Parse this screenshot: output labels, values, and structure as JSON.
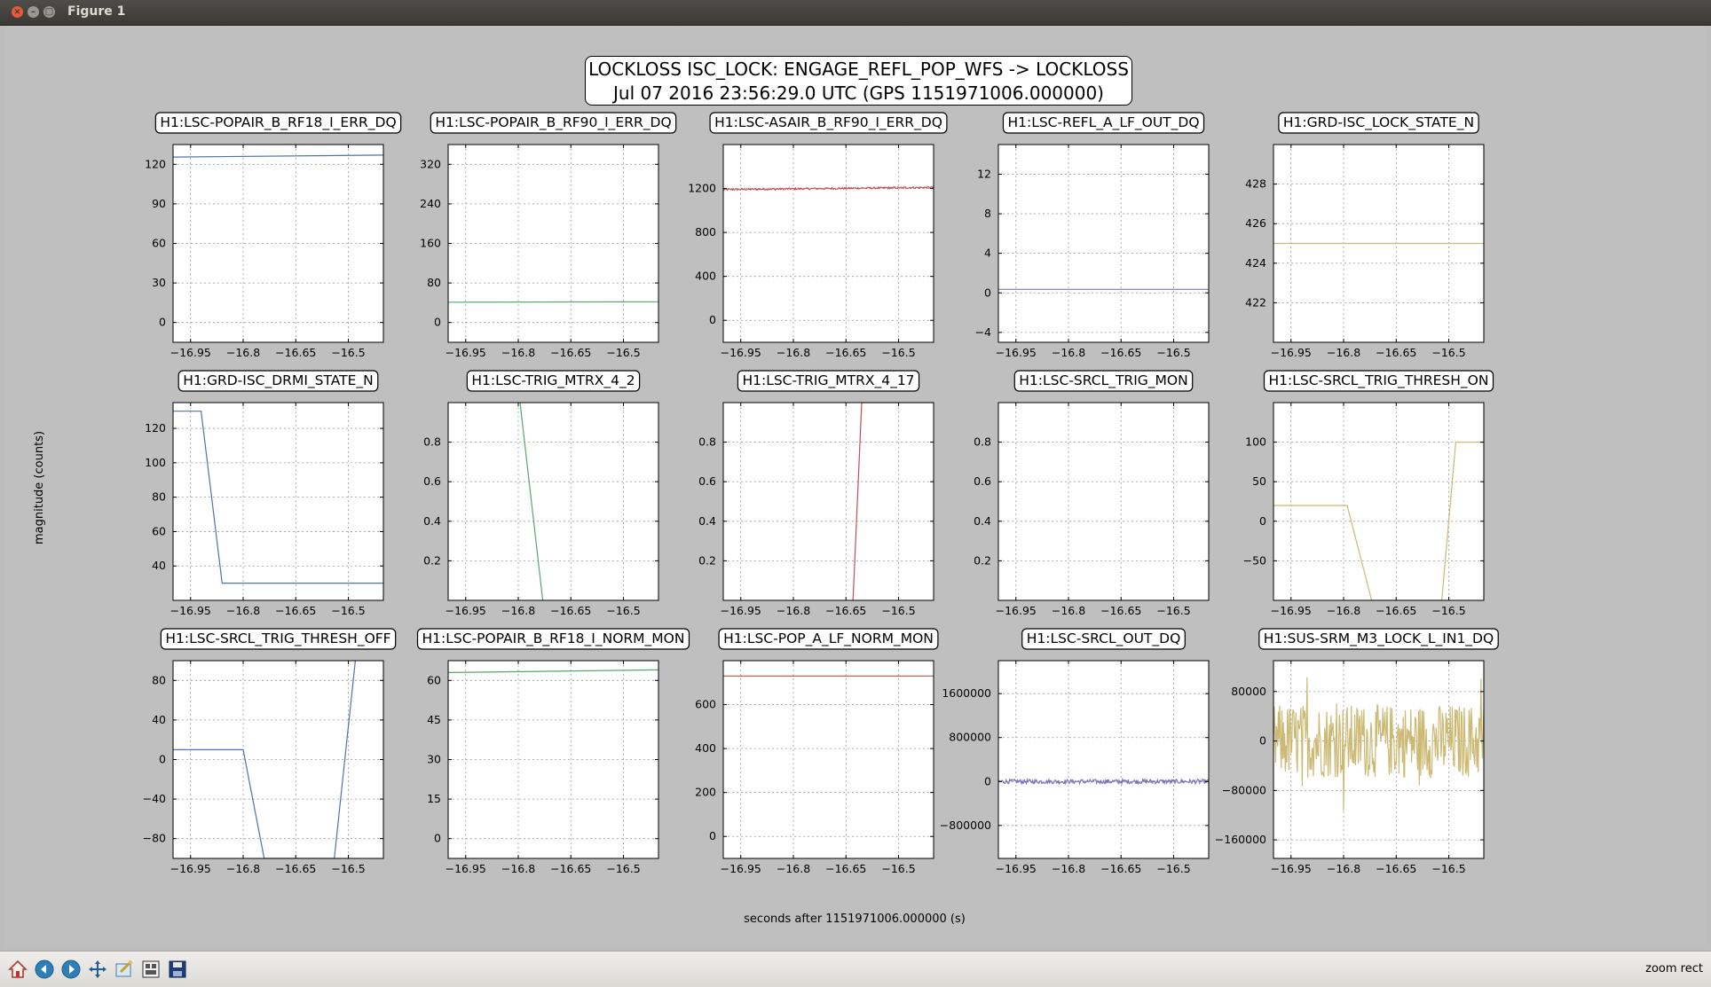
{
  "window": {
    "title": "Figure 1",
    "close_glyph": "×",
    "min_glyph": "–",
    "max_glyph": "□"
  },
  "figure": {
    "title_line1": "LOCKLOSS ISC_LOCK: ENGAGE_REFL_POP_WFS -> LOCKLOSS",
    "title_line2": "Jul 07 2016 23:56:29.0 UTC (GPS 1151971006.000000)",
    "ylabel": "magnitude (counts)",
    "xlabel": "seconds after 1151971006.000000 (s)",
    "grid": true
  },
  "toolbar": {
    "buttons": [
      "home-icon",
      "back-icon",
      "forward-icon",
      "pan-icon",
      "zoom-icon",
      "subplots-icon",
      "save-icon"
    ],
    "status": "zoom rect"
  },
  "colors": {
    "blue": "#4c72b0",
    "green": "#55a868",
    "red": "#c44e52",
    "purple": "#8172b2",
    "gold": "#ccb974"
  },
  "chart_data": [
    {
      "type": "line",
      "title": "H1:LSC-POPAIR_B_RF18_I_ERR_DQ",
      "xlim": [
        -17.0,
        -16.4
      ],
      "ylim": [
        -15,
        135
      ],
      "yticks": [
        0,
        30,
        60,
        90,
        120
      ],
      "ytick_labels": [
        "0",
        "30",
        "60",
        "90",
        "120"
      ],
      "color": "#4c72b0",
      "series": [
        {
          "x": [
            -17.0,
            -16.4
          ],
          "y": [
            125.5,
            127.0
          ]
        }
      ]
    },
    {
      "type": "line",
      "title": "H1:LSC-POPAIR_B_RF90_I_ERR_DQ",
      "xlim": [
        -17.0,
        -16.4
      ],
      "ylim": [
        -40,
        360
      ],
      "yticks": [
        0,
        80,
        160,
        240,
        320
      ],
      "ytick_labels": [
        "0",
        "80",
        "160",
        "240",
        "320"
      ],
      "color": "#55a868",
      "series": [
        {
          "x": [
            -17.0,
            -16.4
          ],
          "y": [
            41,
            42
          ]
        }
      ]
    },
    {
      "type": "line",
      "title": "H1:LSC-ASAIR_B_RF90_I_ERR_DQ",
      "xlim": [
        -17.0,
        -16.4
      ],
      "ylim": [
        -200,
        1600
      ],
      "yticks": [
        0,
        400,
        800,
        1200
      ],
      "ytick_labels": [
        "0",
        "400",
        "800",
        "1200"
      ],
      "color": "#c44e52",
      "noise": 8,
      "series": [
        {
          "x": [
            -17.0,
            -16.4
          ],
          "y": [
            1190,
            1210
          ]
        }
      ]
    },
    {
      "type": "line",
      "title": "H1:LSC-REFL_A_LF_OUT_DQ",
      "xlim": [
        -17.0,
        -16.4
      ],
      "ylim": [
        -5,
        15
      ],
      "yticks": [
        -4,
        0,
        4,
        8,
        12
      ],
      "ytick_labels": [
        "−4",
        "0",
        "4",
        "8",
        "12"
      ],
      "color": "#8172b2",
      "series": [
        {
          "x": [
            -17.0,
            -16.4
          ],
          "y": [
            0.35,
            0.35
          ]
        }
      ]
    },
    {
      "type": "line",
      "title": "H1:GRD-ISC_LOCK_STATE_N",
      "xlim": [
        -17.0,
        -16.4
      ],
      "ylim": [
        420,
        430
      ],
      "yticks": [
        422,
        424,
        426,
        428
      ],
      "ytick_labels": [
        "422",
        "424",
        "426",
        "428"
      ],
      "color": "#ccb974",
      "series": [
        {
          "x": [
            -17.0,
            -16.4
          ],
          "y": [
            425,
            425
          ]
        }
      ]
    },
    {
      "type": "line",
      "title": "H1:GRD-ISC_DRMI_STATE_N",
      "xlim": [
        -17.0,
        -16.4
      ],
      "ylim": [
        20,
        135
      ],
      "yticks": [
        40,
        60,
        80,
        100,
        120
      ],
      "ytick_labels": [
        "40",
        "60",
        "80",
        "100",
        "120"
      ],
      "color": "#4c72b0",
      "series": [
        {
          "x": [
            -17.0,
            -16.92,
            -16.86,
            -16.4
          ],
          "y": [
            130,
            130,
            30,
            30
          ]
        }
      ]
    },
    {
      "type": "line",
      "title": "H1:LSC-TRIG_MTRX_4_2",
      "xlim": [
        -17.0,
        -16.4
      ],
      "ylim": [
        0,
        1
      ],
      "yticks": [
        0.2,
        0.4,
        0.6,
        0.8
      ],
      "ytick_labels": [
        "0.2",
        "0.4",
        "0.6",
        "0.8"
      ],
      "color": "#55a868",
      "series": [
        {
          "x": [
            -16.795,
            -16.73
          ],
          "y": [
            1,
            0
          ]
        }
      ]
    },
    {
      "type": "line",
      "title": "H1:LSC-TRIG_MTRX_4_17",
      "xlim": [
        -17.0,
        -16.4
      ],
      "ylim": [
        0,
        1
      ],
      "yticks": [
        0.2,
        0.4,
        0.6,
        0.8
      ],
      "ytick_labels": [
        "0.2",
        "0.4",
        "0.6",
        "0.8"
      ],
      "color": "#c44e52",
      "series": [
        {
          "x": [
            -16.63,
            -16.605,
            -16.4
          ],
          "y": [
            0,
            1,
            1
          ]
        }
      ]
    },
    {
      "type": "line",
      "title": "H1:LSC-SRCL_TRIG_MON",
      "xlim": [
        -17.0,
        -16.4
      ],
      "ylim": [
        0,
        1
      ],
      "yticks": [
        0.2,
        0.4,
        0.6,
        0.8
      ],
      "ytick_labels": [
        "0.2",
        "0.4",
        "0.6",
        "0.8"
      ],
      "color": "#8172b2",
      "series": [
        {
          "x": [],
          "y": []
        }
      ]
    },
    {
      "type": "line",
      "title": "H1:LSC-SRCL_TRIG_THRESH_ON",
      "xlim": [
        -17.0,
        -16.4
      ],
      "ylim": [
        -100,
        150
      ],
      "yticks": [
        -50,
        0,
        50,
        100
      ],
      "ytick_labels": [
        "−50",
        "0",
        "50",
        "100"
      ],
      "color": "#ccb974",
      "series": [
        {
          "x": [
            -17.0,
            -16.79,
            -16.72,
            -16.52,
            -16.48,
            -16.4
          ],
          "y": [
            20,
            20,
            -100,
            -100,
            100,
            100
          ]
        }
      ]
    },
    {
      "type": "line",
      "title": "H1:LSC-SRCL_TRIG_THRESH_OFF",
      "xlim": [
        -17.0,
        -16.4
      ],
      "ylim": [
        -100,
        100
      ],
      "yticks": [
        -80,
        -40,
        0,
        40,
        80
      ],
      "ytick_labels": [
        "−80",
        "−40",
        "0",
        "40",
        "80"
      ],
      "color": "#4c72b0",
      "series": [
        {
          "x": [
            -17.0,
            -16.8,
            -16.74,
            -16.54,
            -16.48
          ],
          "y": [
            10,
            10,
            -100,
            -100,
            100
          ]
        }
      ]
    },
    {
      "type": "line",
      "title": "H1:LSC-POPAIR_B_RF18_I_NORM_MON",
      "xlim": [
        -17.0,
        -16.4
      ],
      "ylim": [
        -7.5,
        67.5
      ],
      "yticks": [
        0,
        15,
        30,
        45,
        60
      ],
      "ytick_labels": [
        "0",
        "15",
        "30",
        "45",
        "60"
      ],
      "color": "#55a868",
      "series": [
        {
          "x": [
            -17.0,
            -16.4
          ],
          "y": [
            63,
            64
          ]
        }
      ]
    },
    {
      "type": "line",
      "title": "H1:LSC-POP_A_LF_NORM_MON",
      "xlim": [
        -17.0,
        -16.4
      ],
      "ylim": [
        -100,
        800
      ],
      "yticks": [
        0,
        200,
        400,
        600
      ],
      "ytick_labels": [
        "0",
        "200",
        "400",
        "600"
      ],
      "color": "#c44e52",
      "series": [
        {
          "x": [
            -17.0,
            -16.4
          ],
          "y": [
            730,
            730
          ]
        }
      ]
    },
    {
      "type": "line",
      "title": "H1:LSC-SRCL_OUT_DQ",
      "xlim": [
        -17.0,
        -16.4
      ],
      "ylim": [
        -1400000,
        2200000
      ],
      "yticks": [
        -800000,
        0,
        800000,
        1600000
      ],
      "ytick_labels": [
        "−800000",
        "0",
        "800000",
        "1600000"
      ],
      "color": "#8172b2",
      "noise": 40000,
      "series": [
        {
          "x": [
            -17.0,
            -16.4
          ],
          "y": [
            0,
            0
          ]
        }
      ]
    },
    {
      "type": "line",
      "title": "H1:SUS-SRM_M3_LOCK_L_IN1_DQ",
      "xlim": [
        -17.0,
        -16.4
      ],
      "ylim": [
        -190000,
        130000
      ],
      "yticks": [
        -160000,
        -80000,
        0,
        80000
      ],
      "ytick_labels": [
        "−160000",
        "−80000",
        "0",
        "80000"
      ],
      "color": "#ccb974",
      "noise": 60000,
      "series": [
        {
          "x": [
            -17.0,
            -16.4
          ],
          "y": [
            0,
            0
          ]
        }
      ]
    }
  ],
  "xticks": [
    -16.95,
    -16.8,
    -16.65,
    -16.5
  ],
  "xtick_labels": [
    "−16.95",
    "−16.8",
    "−16.65",
    "−16.5"
  ]
}
